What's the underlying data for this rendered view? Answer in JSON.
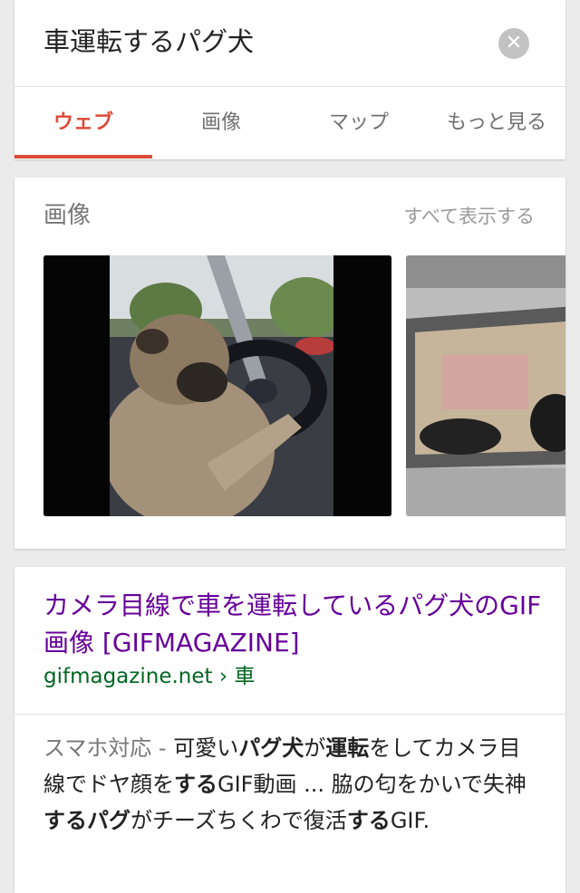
{
  "search": {
    "query": "車運転するパグ犬",
    "clear_icon": "close-icon"
  },
  "tabs": [
    {
      "label": "ウェブ",
      "active": true
    },
    {
      "label": "画像",
      "active": false
    },
    {
      "label": "マップ",
      "active": false
    },
    {
      "label": "もっと見る",
      "active": false
    }
  ],
  "images": {
    "title": "画像",
    "show_all": "すべて表示する",
    "thumbnails": [
      {
        "subject": "pug-driving-car-gif-thumbnail"
      },
      {
        "subject": "car-window-thumbnail"
      }
    ]
  },
  "result": {
    "title": "カメラ目線で車を運転しているパグ犬のGIF画像 [GIFMAGAZINE]",
    "url": "gifmagazine.net › 車",
    "snippet": [
      {
        "text": "スマホ対応 - ",
        "style": "meta"
      },
      {
        "text": "可愛い",
        "style": "normal"
      },
      {
        "text": "パグ犬",
        "style": "bold"
      },
      {
        "text": "が",
        "style": "normal"
      },
      {
        "text": "運転",
        "style": "bold"
      },
      {
        "text": "をしてカメラ目線でドヤ顔を",
        "style": "normal"
      },
      {
        "text": "する",
        "style": "bold"
      },
      {
        "text": "GIF動画 ... 脇の匂をかいで失神",
        "style": "normal"
      },
      {
        "text": "する",
        "style": "bold"
      },
      {
        "text": "パグ",
        "style": "bold"
      },
      {
        "text": "がチーズちくわで復活",
        "style": "normal"
      },
      {
        "text": "する",
        "style": "bold"
      },
      {
        "text": "GIF.",
        "style": "normal"
      }
    ]
  },
  "colors": {
    "accent": "#dd4b39",
    "visited_link": "#660099",
    "url_green": "#006621",
    "background": "#ebebeb"
  }
}
